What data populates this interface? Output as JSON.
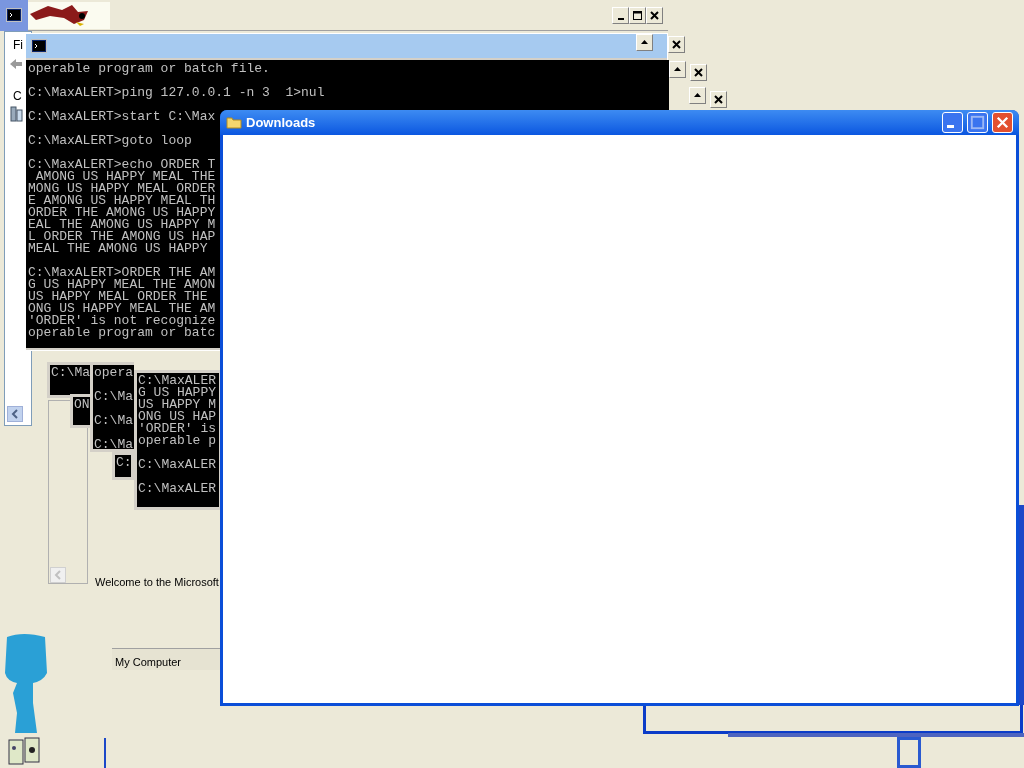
{
  "explorer_window": {
    "menu_text": "Fi",
    "address_text": "C"
  },
  "console": {
    "blocks": [
      [
        "operable program or batch file."
      ],
      [
        "C:\\MaxALERT>ping 127.0.0.1 -n 3  1>nul"
      ],
      [
        "C:\\MaxALERT>start C:\\Max"
      ],
      [
        "C:\\MaxALERT>goto loop"
      ],
      [
        "C:\\MaxALERT>echo ORDER T",
        " AMONG US HAPPY MEAL THE",
        "MONG US HAPPY MEAL ORDER",
        "E AMONG US HAPPY MEAL TH",
        "ORDER THE AMONG US HAPPY",
        "EAL THE AMONG US HAPPY M",
        "L ORDER THE AMONG US HAP",
        "MEAL THE AMONG US HAPPY"
      ],
      [
        "C:\\MaxALERT>ORDER THE AM",
        "G US HAPPY MEAL THE AMON",
        "US HAPPY MEAL ORDER THE",
        "ONG US HAPPY MEAL THE AM",
        "'ORDER' is not recognize",
        "operable program or batc"
      ]
    ]
  },
  "console_fragments": [
    {
      "blocks": [
        [
          "C:\\Ma"
        ]
      ]
    },
    {
      "blocks": [
        [
          "ON"
        ]
      ]
    },
    {
      "blocks": [
        [
          "opera"
        ],
        [
          "C:\\Ma"
        ],
        [
          "C:\\Ma"
        ],
        [
          "C:\\Ma"
        ]
      ]
    },
    {
      "blocks": [
        [
          "C:"
        ]
      ]
    },
    {
      "blocks": [
        [
          "C:\\MaxALER",
          "G US HAPPY",
          "US HAPPY M",
          "ONG US HAP",
          "'ORDER' is",
          "operable p"
        ],
        [
          "C:\\MaxALER"
        ],
        [
          "C:\\MaxALER"
        ]
      ]
    }
  ],
  "welcome_text": "Welcome to the Microsoft",
  "my_computer_label": "My Computer",
  "downloads_window": {
    "title": "Downloads"
  }
}
